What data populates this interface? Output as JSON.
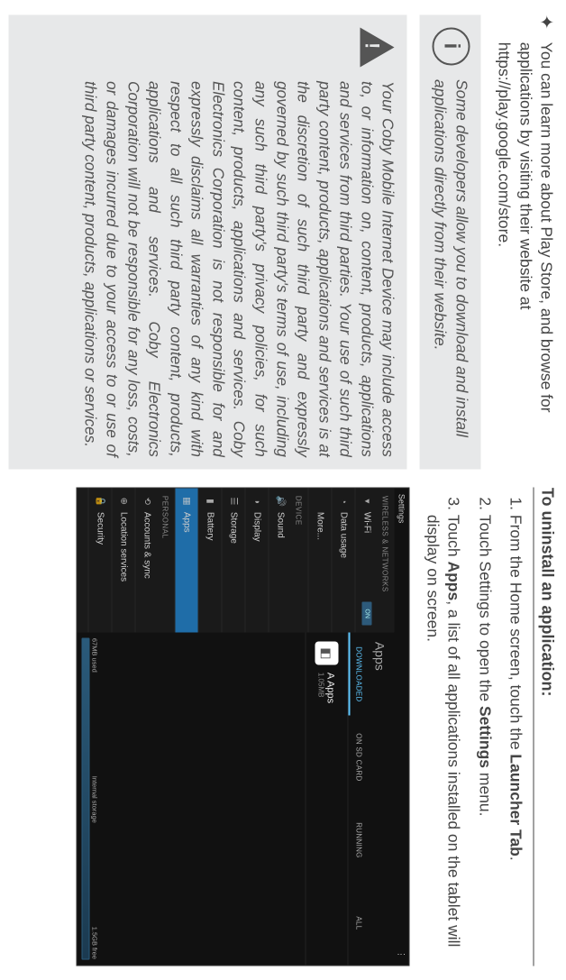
{
  "left": {
    "bullet_text": "You can learn more about Play Store, and browse for applications by visiting their website at https://play.google.com/store.",
    "callout_text": "Some developers allow you to download and install applications directly from their website.",
    "warning_text": "Your Coby Mobile Internet Device may include access to, or information on, content, products, applications and services from third parties. Your use of such third party content, products, applications and services is at the discretion of such third party and expressly governed by such third party's terms of use, including any such third party's privacy policies, for such content, products, applications and services. Coby Electronics Corporation is not responsible for and expressly disclaims all warranties of any kind with respect to all such third party content, products, applications and services. Coby Electronics Corporation will not be responsible for any loss, costs, or damages incurred due to your access to or use of third party content, products, applications or services."
  },
  "right": {
    "heading": "To uninstall an application:",
    "steps": [
      "From the Home screen, touch the <b>Launcher Tab</b>.",
      "Touch Settings to open the <b>Settings</b> menu.",
      "Touch <b>Apps</b>, a list of all applications installed on the tablet will display on screen."
    ]
  },
  "shot": {
    "statusbar": {
      "title": "Settings"
    },
    "main_title": "Apps",
    "sidebar": {
      "section1": "WIRELESS & NETWORKS",
      "wifi": "Wi-Fi",
      "wifi_toggle": "ON",
      "data_usage": "Data usage",
      "more": "More...",
      "section2": "DEVICE",
      "sound": "Sound",
      "display": "Display",
      "storage": "Storage",
      "battery": "Battery",
      "apps": "Apps",
      "section3": "PERSONAL",
      "accounts": "Accounts & sync",
      "location": "Location services",
      "security": "Security"
    },
    "tabs": {
      "downloaded": "DOWNLOADED",
      "on_sd": "ON SD CARD",
      "running": "RUNNING",
      "all": "ALL"
    },
    "app": {
      "name": "A Apps",
      "size": "1.05MB"
    },
    "storage": {
      "used": "67MB used",
      "label": "Internal storage",
      "free": "1.5GB free"
    }
  }
}
